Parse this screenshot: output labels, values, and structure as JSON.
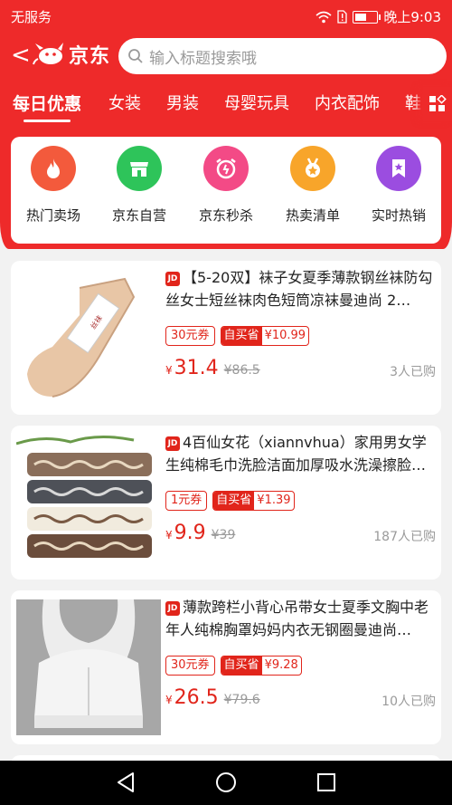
{
  "status": {
    "carrier": "无服务",
    "time": "晚上9:03",
    "battery_level": 0.6
  },
  "header": {
    "back_symbol": "<",
    "logo_text": "京东",
    "search_placeholder": "输入标题搜索哦"
  },
  "tabs": [
    {
      "label": "每日优惠",
      "active": true
    },
    {
      "label": "女装"
    },
    {
      "label": "男装"
    },
    {
      "label": "母婴玩具"
    },
    {
      "label": "内衣配饰"
    },
    {
      "label": "鞋"
    }
  ],
  "categories": [
    {
      "label": "热门卖场",
      "icon": "flame-icon",
      "color": "#f35a3c"
    },
    {
      "label": "京东自营",
      "icon": "store-icon",
      "color": "#2ec45a"
    },
    {
      "label": "京东秒杀",
      "icon": "alarm-clock-icon",
      "color": "#f34a86"
    },
    {
      "label": "热卖清单",
      "icon": "medal-icon",
      "color": "#f8a52a"
    },
    {
      "label": "实时热销",
      "icon": "bookmark-star-icon",
      "color": "#9b4de0"
    }
  ],
  "products": [
    {
      "jd_badge": "JD",
      "title": "【5-20双】袜子女夏季薄款钢丝袜防勾丝女士短丝袜肉色短筒凉袜曼迪尚 2…",
      "coupon": "30元券",
      "self_label": "自买省",
      "self_save": "¥10.99",
      "currency": "¥",
      "price": "31.4",
      "old_price": "¥86.5",
      "sold": "3人已购"
    },
    {
      "jd_badge": "JD",
      "title": "4百仙女花（xiannvhua）家用男女学生纯棉毛巾洗脸洁面加厚吸水洗澡擦脸…",
      "coupon": "1元券",
      "self_label": "自买省",
      "self_save": "¥1.39",
      "currency": "¥",
      "price": "9.9",
      "old_price": "¥39",
      "sold": "187人已购"
    },
    {
      "jd_badge": "JD",
      "title": "薄款跨栏小背心吊带女士夏季文胸中老年人纯棉胸罩妈妈内衣无钢圈曼迪尚…",
      "coupon": "30元券",
      "self_label": "自买省",
      "self_save": "¥9.28",
      "currency": "¥",
      "price": "26.5",
      "old_price": "¥79.6",
      "sold": "10人已购"
    }
  ],
  "colors": {
    "brand_red": "#ee2a2a",
    "price_red": "#e1251b"
  }
}
